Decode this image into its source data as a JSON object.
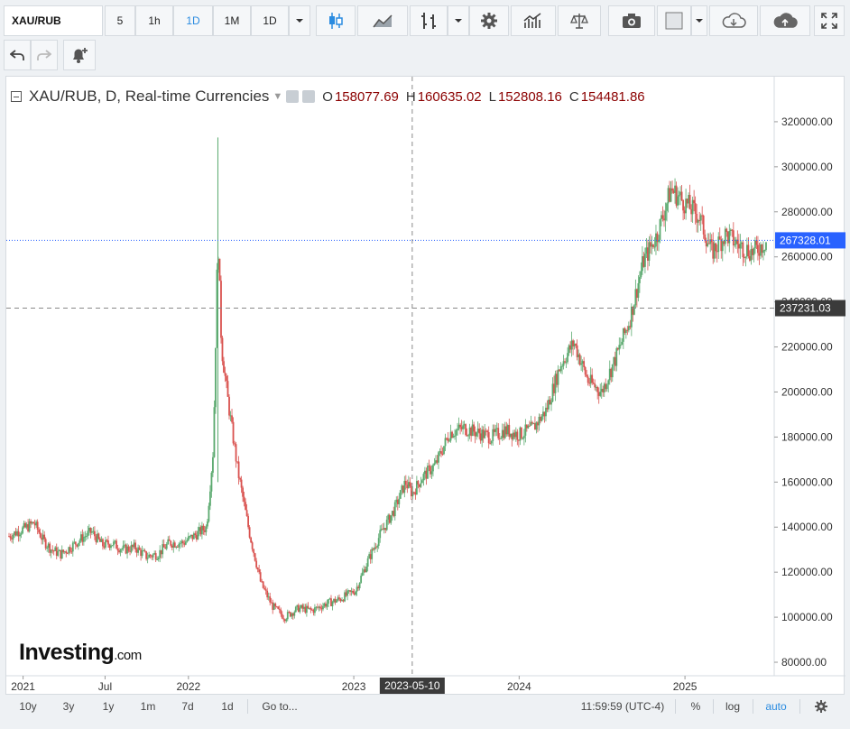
{
  "toolbar": {
    "symbol": "XAU/RUB",
    "intervals": [
      "5",
      "1h",
      "1D",
      "1M",
      "1D"
    ],
    "active_interval": "1D"
  },
  "legend": {
    "title": "XAU/RUB, D, Real-time Currencies",
    "open_label": "O",
    "open": "158077.69",
    "high_label": "H",
    "high": "160635.02",
    "low_label": "L",
    "low": "152808.16",
    "close_label": "C",
    "close": "154481.86"
  },
  "price_labels": {
    "last": "267328.01",
    "crosshair": "237231.03",
    "crosshair_date": "2023-05-10"
  },
  "logo": {
    "brand": "Investing",
    "suffix": ".com"
  },
  "bottom_bar": {
    "ranges": [
      "10y",
      "3y",
      "1y",
      "1m",
      "7d",
      "1d"
    ],
    "goto": "Go to...",
    "time": "11:59:59 (UTC-4)",
    "percent": "%",
    "log": "log",
    "auto": "auto"
  },
  "colors": {
    "up": "#5aa96e",
    "down": "#d9524f",
    "last_line": "#2962ff",
    "last_label_bg": "#2962ff",
    "crosshair_bg": "#3b3b3b"
  },
  "chart_data": {
    "type": "candlestick",
    "x_ticks": [
      "2021",
      "Jul",
      "2022",
      "2023",
      "2024",
      "2025"
    ],
    "y_ticks": [
      80000,
      100000,
      120000,
      140000,
      160000,
      180000,
      200000,
      220000,
      240000,
      260000,
      280000,
      300000,
      320000
    ],
    "y_tick_labels": [
      "80000.00",
      "100000.00",
      "120000.00",
      "140000.00",
      "160000.00",
      "180000.00",
      "200000.00",
      "220000.00",
      "240000.00",
      "260000.00",
      "280000.00",
      "300000.00",
      "320000.00"
    ],
    "ylim": [
      74000,
      340000
    ],
    "xlim": [
      "2020-11-25",
      "2025-07-15"
    ],
    "last_value": 267328.01,
    "crosshair": {
      "date": "2023-05-10",
      "value": 237231.03
    },
    "series": [
      {
        "date": "2020-12-01",
        "value": 136000
      },
      {
        "date": "2020-12-20",
        "value": 138000
      },
      {
        "date": "2021-01-10",
        "value": 140000
      },
      {
        "date": "2021-01-25",
        "value": 142000
      },
      {
        "date": "2021-02-15",
        "value": 134000
      },
      {
        "date": "2021-03-05",
        "value": 130000
      },
      {
        "date": "2021-03-25",
        "value": 128000
      },
      {
        "date": "2021-04-15",
        "value": 131000
      },
      {
        "date": "2021-05-10",
        "value": 135000
      },
      {
        "date": "2021-06-01",
        "value": 138000
      },
      {
        "date": "2021-06-25",
        "value": 132000
      },
      {
        "date": "2021-07-15",
        "value": 133000
      },
      {
        "date": "2021-08-10",
        "value": 130000
      },
      {
        "date": "2021-09-05",
        "value": 131000
      },
      {
        "date": "2021-09-30",
        "value": 127000
      },
      {
        "date": "2021-10-25",
        "value": 128000
      },
      {
        "date": "2021-11-20",
        "value": 133000
      },
      {
        "date": "2021-12-20",
        "value": 133000
      },
      {
        "date": "2022-01-20",
        "value": 137000
      },
      {
        "date": "2022-02-10",
        "value": 140000
      },
      {
        "date": "2022-02-25",
        "value": 175000
      },
      {
        "date": "2022-03-07",
        "value": 270000
      },
      {
        "date": "2022-03-15",
        "value": 220000
      },
      {
        "date": "2022-03-30",
        "value": 195000
      },
      {
        "date": "2022-04-20",
        "value": 165000
      },
      {
        "date": "2022-05-15",
        "value": 138000
      },
      {
        "date": "2022-06-10",
        "value": 115000
      },
      {
        "date": "2022-07-05",
        "value": 105000
      },
      {
        "date": "2022-08-01",
        "value": 100000
      },
      {
        "date": "2022-09-01",
        "value": 104000
      },
      {
        "date": "2022-10-01",
        "value": 103000
      },
      {
        "date": "2022-11-01",
        "value": 106000
      },
      {
        "date": "2022-12-01",
        "value": 108000
      },
      {
        "date": "2023-01-05",
        "value": 112000
      },
      {
        "date": "2023-02-01",
        "value": 125000
      },
      {
        "date": "2023-03-01",
        "value": 137000
      },
      {
        "date": "2023-04-01",
        "value": 148000
      },
      {
        "date": "2023-04-25",
        "value": 160000
      },
      {
        "date": "2023-05-10",
        "value": 155000
      },
      {
        "date": "2023-06-01",
        "value": 162000
      },
      {
        "date": "2023-07-01",
        "value": 168000
      },
      {
        "date": "2023-08-01",
        "value": 182000
      },
      {
        "date": "2023-09-01",
        "value": 184000
      },
      {
        "date": "2023-10-01",
        "value": 182000
      },
      {
        "date": "2023-11-01",
        "value": 180000
      },
      {
        "date": "2023-12-01",
        "value": 183000
      },
      {
        "date": "2024-01-01",
        "value": 181000
      },
      {
        "date": "2024-02-01",
        "value": 184000
      },
      {
        "date": "2024-03-01",
        "value": 192000
      },
      {
        "date": "2024-04-01",
        "value": 212000
      },
      {
        "date": "2024-05-01",
        "value": 222000
      },
      {
        "date": "2024-06-01",
        "value": 205000
      },
      {
        "date": "2024-07-01",
        "value": 200000
      },
      {
        "date": "2024-08-01",
        "value": 215000
      },
      {
        "date": "2024-09-01",
        "value": 232000
      },
      {
        "date": "2024-10-01",
        "value": 258000
      },
      {
        "date": "2024-11-01",
        "value": 270000
      },
      {
        "date": "2024-12-01",
        "value": 290000
      },
      {
        "date": "2025-01-01",
        "value": 284000
      },
      {
        "date": "2025-02-01",
        "value": 278000
      },
      {
        "date": "2025-03-01",
        "value": 262000
      },
      {
        "date": "2025-04-01",
        "value": 270000
      },
      {
        "date": "2025-05-01",
        "value": 265000
      },
      {
        "date": "2025-06-01",
        "value": 262000
      },
      {
        "date": "2025-07-01",
        "value": 267328
      }
    ]
  }
}
